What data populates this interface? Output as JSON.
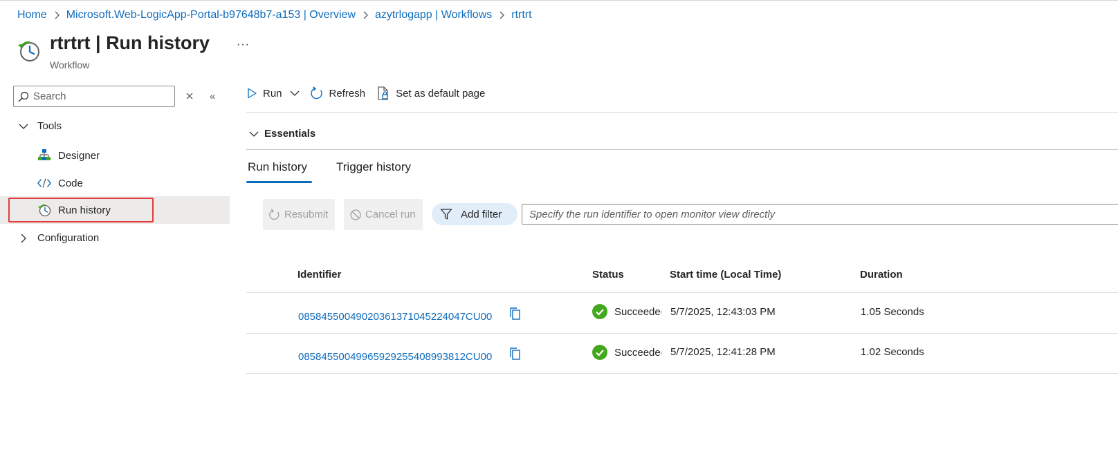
{
  "breadcrumb": [
    {
      "label": "Home"
    },
    {
      "label": "Microsoft.Web-LogicApp-Portal-b97648b7-a153 | Overview"
    },
    {
      "label": "azytrlogapp | Workflows"
    },
    {
      "label": "rtrtrt"
    }
  ],
  "header": {
    "name": "rtrtrt",
    "separator": " | ",
    "section": "Run history",
    "subtitle": "Workflow",
    "more": "···"
  },
  "sidebar": {
    "search_placeholder": "Search",
    "collapse_glyph": "«",
    "groups": [
      {
        "label": "Tools",
        "expanded": true
      },
      {
        "label": "Configuration",
        "expanded": false
      }
    ],
    "items": [
      {
        "label": "Designer",
        "icon": "designer-icon"
      },
      {
        "label": "Code",
        "icon": "code-icon"
      },
      {
        "label": "Run history",
        "icon": "run-history-icon",
        "selected": true
      }
    ]
  },
  "toolbar": {
    "run_label": "Run",
    "refresh_label": "Refresh",
    "default_page_label": "Set as default page"
  },
  "essentials": {
    "label": "Essentials",
    "expanded": false
  },
  "tabs": [
    {
      "label": "Run history",
      "active": true
    },
    {
      "label": "Trigger history",
      "active": false
    }
  ],
  "filters": {
    "resubmit_label": "Resubmit",
    "cancel_run_label": "Cancel run",
    "add_filter_label": "Add filter",
    "run_id_placeholder": "Specify the run identifier to open monitor view directly"
  },
  "table": {
    "columns": [
      "Identifier",
      "Status",
      "Start time (Local Time)",
      "Duration"
    ],
    "rows": [
      {
        "identifier": "08584550049020361371045224047CU00",
        "status": "Succeeded",
        "start_time": "5/7/2025, 12:43:03 PM",
        "duration": "1.05 Seconds"
      },
      {
        "identifier": "08584550049965929255408993812CU00",
        "status": "Succeeded",
        "start_time": "5/7/2025, 12:41:28 PM",
        "duration": "1.02 Seconds"
      }
    ]
  },
  "colors": {
    "link": "#0f6cbd",
    "success": "#43a81e",
    "selection_highlight": "#e03c3c",
    "selected_bg": "#edebe9"
  }
}
